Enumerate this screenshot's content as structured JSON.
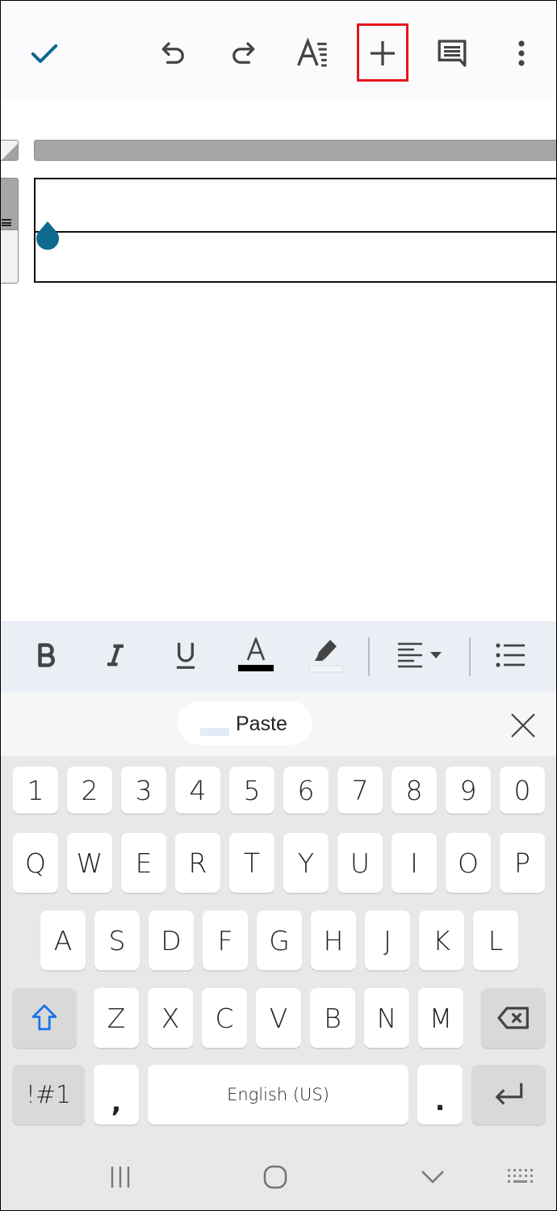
{
  "toolbar": {
    "buttons": [
      {
        "name": "confirm",
        "icon": "check-icon"
      },
      {
        "name": "undo",
        "icon": "undo-icon"
      },
      {
        "name": "redo",
        "icon": "redo-icon"
      },
      {
        "name": "text-format",
        "icon": "text-format-icon"
      },
      {
        "name": "insert",
        "icon": "plus-icon",
        "highlighted": true
      },
      {
        "name": "comment",
        "icon": "comment-icon"
      },
      {
        "name": "more-options",
        "icon": "more-vertical-icon"
      }
    ],
    "accent_color": "#0e6a8e",
    "highlight_color": "#e8141b"
  },
  "document": {
    "table": {
      "rows": 2,
      "cells": [
        "",
        ""
      ]
    },
    "cursor_color": "#0e6a8e"
  },
  "format_bar": {
    "buttons": [
      {
        "name": "bold",
        "icon": "bold-icon",
        "glyph": "B"
      },
      {
        "name": "italic",
        "icon": "italic-icon",
        "glyph": "I"
      },
      {
        "name": "underline",
        "icon": "underline-icon",
        "glyph": "U"
      },
      {
        "name": "text-color",
        "icon": "text-color-icon",
        "glyph": "A",
        "color": "#000000"
      },
      {
        "name": "highlight-color",
        "icon": "highlighter-icon",
        "color": "none"
      },
      {
        "name": "align",
        "icon": "align-left-icon"
      },
      {
        "name": "bulleted-list",
        "icon": "bullet-list-icon"
      }
    ]
  },
  "suggestion_bar": {
    "paste_label": "Paste"
  },
  "keyboard": {
    "number_row": [
      "1",
      "2",
      "3",
      "4",
      "5",
      "6",
      "7",
      "8",
      "9",
      "0"
    ],
    "row1": [
      "Q",
      "W",
      "E",
      "R",
      "T",
      "Y",
      "U",
      "I",
      "O",
      "P"
    ],
    "row2": [
      "A",
      "S",
      "D",
      "F",
      "G",
      "H",
      "J",
      "K",
      "L"
    ],
    "row3": [
      "Z",
      "X",
      "C",
      "V",
      "B",
      "N",
      "M"
    ],
    "symbols_label": "!#1",
    "comma_label": ",",
    "space_label": "English (US)",
    "period_label": ".",
    "shift_color": "#1a73e8"
  },
  "navbar": {
    "buttons": [
      {
        "name": "recents",
        "icon": "recents-icon"
      },
      {
        "name": "home",
        "icon": "home-icon"
      },
      {
        "name": "hide-keyboard",
        "icon": "chevron-down-icon"
      },
      {
        "name": "keyboard-switch",
        "icon": "keyboard-icon"
      }
    ]
  }
}
